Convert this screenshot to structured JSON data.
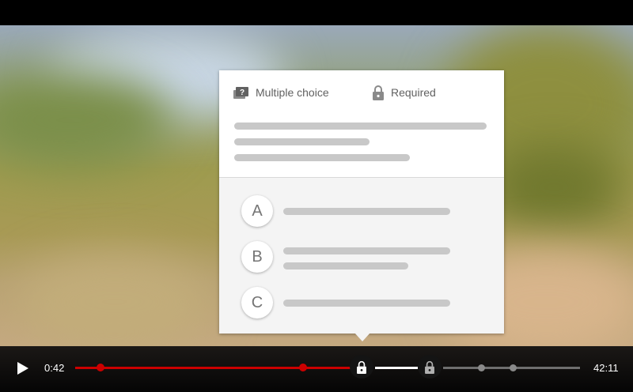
{
  "quiz": {
    "type_label": "Multiple choice",
    "required_label": "Required",
    "options": [
      {
        "letter": "A"
      },
      {
        "letter": "B"
      },
      {
        "letter": "C"
      }
    ]
  },
  "player": {
    "current_time": "0:42",
    "duration": "42:11",
    "progress_color": "#cc0000"
  },
  "icons": {
    "question": "question-badge-icon",
    "lock": "lock-icon",
    "play": "play-icon"
  }
}
